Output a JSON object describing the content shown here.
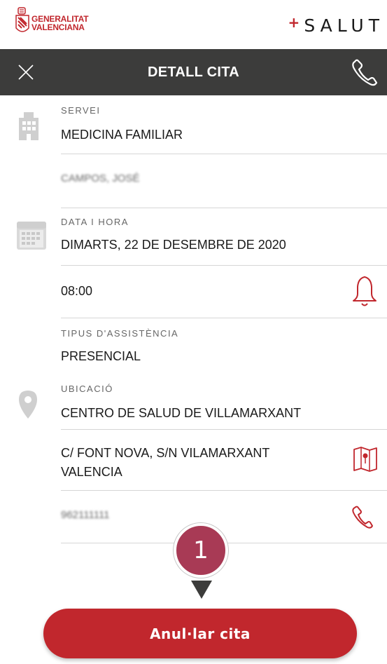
{
  "brand": {
    "org_line1": "GENERALITAT",
    "org_line2": "VALENCIANA",
    "app_plus": "+",
    "app_name": "SALUT"
  },
  "header": {
    "title": "DETALL CITA",
    "close_icon": "close-icon",
    "phone_icon": "phone-icon"
  },
  "appointment": {
    "service_label": "SERVEI",
    "service_value": "MEDICINA FAMILIAR",
    "doctor_value": "CAMPOS, JOSÉ",
    "datetime_label": "DATA I HORA",
    "date_value": "DIMARTS, 22 DE DESEMBRE DE 2020",
    "time_value": "08:00",
    "assistance_label": "TIPUS D'ASSISTÈNCIA",
    "assistance_value": "PRESENCIAL",
    "location_label": "UBICACIÓ",
    "center_value": "CENTRO DE SALUD DE VILLAMARXANT",
    "address_line1": "C/ FONT NOVA, S/N VILAMARXANT",
    "address_line2": "VALENCIA",
    "phone_value": "962111111"
  },
  "annotation": {
    "step_number": "1"
  },
  "actions": {
    "cancel_label": "Anul·lar cita"
  },
  "colors": {
    "accent": "#c1272d",
    "header_bg": "#3c3c3b",
    "badge": "#a83a55",
    "side_icon": "#cfcfcf"
  }
}
